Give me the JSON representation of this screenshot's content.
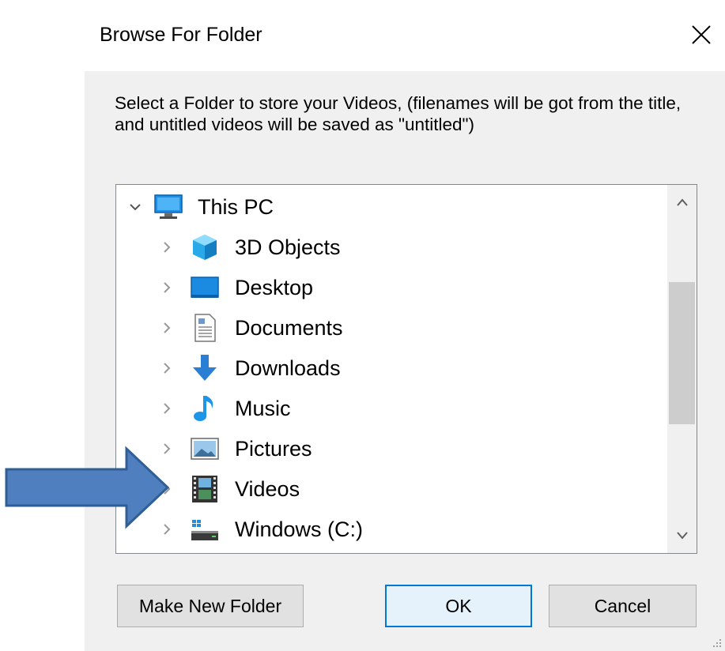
{
  "window": {
    "title": "Browse For Folder",
    "close_glyph": "✕"
  },
  "dialog": {
    "description": "Select a Folder to store your Videos, (filenames will be got from the title, and untitled videos will be saved as \"untitled\")"
  },
  "tree": {
    "root": {
      "label": "This PC",
      "icon": "this-pc-icon",
      "expanded": true
    },
    "items": [
      {
        "label": "3D Objects",
        "icon": "3d-objects-icon"
      },
      {
        "label": "Desktop",
        "icon": "desktop-icon"
      },
      {
        "label": "Documents",
        "icon": "documents-icon"
      },
      {
        "label": "Downloads",
        "icon": "downloads-icon"
      },
      {
        "label": "Music",
        "icon": "music-icon"
      },
      {
        "label": "Pictures",
        "icon": "pictures-icon"
      },
      {
        "label": "Videos",
        "icon": "videos-icon"
      },
      {
        "label": "Windows (C:)",
        "icon": "windows-drive-icon"
      }
    ]
  },
  "buttons": {
    "make_new_folder": "Make New Folder",
    "ok": "OK",
    "cancel": "Cancel"
  },
  "colors": {
    "accent": "#0078d7",
    "annotation_arrow": "#4f7fbf"
  }
}
